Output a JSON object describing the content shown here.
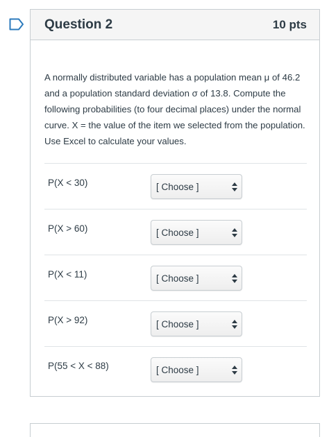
{
  "question": {
    "title": "Question 2",
    "points": "10 pts",
    "text": "A normally distributed variable has a population mean μ of 46.2 and a population standard deviation σ of 13.8. Compute the following probabilities (to four decimal places) under the normal curve. X = the value of the item we selected from the population. Use Excel to calculate your values.",
    "answers": [
      {
        "label": "P(X < 30)",
        "selected": "[ Choose ]"
      },
      {
        "label": "P(X > 60)",
        "selected": "[ Choose ]"
      },
      {
        "label": "P(X < 11)",
        "selected": "[ Choose ]"
      },
      {
        "label": "P(X > 92)",
        "selected": "[ Choose ]"
      },
      {
        "label": "P(55 < X < 88)",
        "selected": "[ Choose ]"
      }
    ]
  },
  "icons": {
    "flag": "flag-question-icon",
    "select_arrows": "up-down-arrows-icon"
  },
  "colors": {
    "flag": "#2b7abc",
    "text": "#2d3b45",
    "border": "#c7cdd1",
    "header_bg": "#f5f5f5"
  }
}
